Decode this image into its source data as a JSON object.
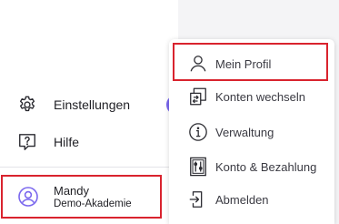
{
  "sidebar": {
    "settings_label": "Einstellungen",
    "help_label": "Hilfe"
  },
  "profile": {
    "name": "Mandy",
    "organization": "Demo-Akademie"
  },
  "menu": {
    "items": [
      {
        "label": "Mein Profil",
        "icon": "person-icon"
      },
      {
        "label": "Konten wechseln",
        "icon": "switch-accounts-icon"
      },
      {
        "label": "Verwaltung",
        "icon": "info-icon"
      },
      {
        "label": "Konto & Bezahlung",
        "icon": "billing-icon"
      },
      {
        "label": "Abmelden",
        "icon": "logout-icon"
      }
    ]
  },
  "colors": {
    "highlight": "#d9232e",
    "accent": "#7b68ee",
    "avatar": "#7b68ee"
  }
}
